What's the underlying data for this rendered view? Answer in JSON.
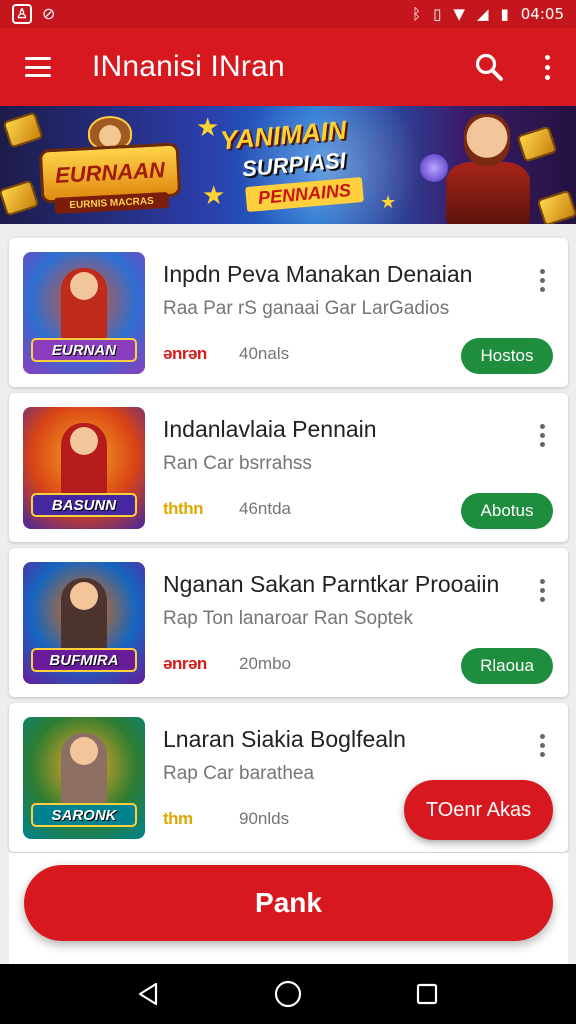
{
  "status_bar": {
    "time": "04:05",
    "left_icons": [
      "app-notification-icon",
      "muted-icon"
    ],
    "right_icons": [
      "bluetooth-icon",
      "vibrate-icon",
      "wifi-icon",
      "signal-icon",
      "battery-icon"
    ]
  },
  "app_bar": {
    "title": "INnanisi INran",
    "menu_icon": "hamburger-menu-icon",
    "search_icon": "search-icon",
    "more_icon": "more-vertical-icon"
  },
  "banner": {
    "logo_text": "EURNAAN",
    "logo_subtext": "EURNIS MACRAS",
    "headline_1": "YANIMAIN",
    "headline_2": "SURPIASI",
    "headline_3": "PENNAINS"
  },
  "items": [
    {
      "title": "Inpdn Peva Manakan Denaian",
      "subtitle": "Raa Par rS ganaai Gar LarGadios",
      "rating": "ənrən",
      "count": "40nals",
      "action": "Hostos",
      "thumb_label": "EURNAN",
      "thumb_colors": [
        "#2e6fd1",
        "#e0542a",
        "#8a3dbf"
      ],
      "fig_color": "#c02a1a",
      "rating_style": "red"
    },
    {
      "title": "Indanlavlaia Pennain",
      "subtitle": "Ran Car bsrrahss",
      "rating": "ththn",
      "count": "46ntda",
      "action": "Abotus",
      "thumb_label": "BASUNN",
      "thumb_colors": [
        "#d84315",
        "#f9a825",
        "#4527a0"
      ],
      "fig_color": "#b71c1c",
      "rating_style": "gold"
    },
    {
      "title": "Nganan Sakan Parntkar Prooaiin",
      "subtitle": "Rap Ton lanaroar Ran Soptek",
      "rating": "ənrən",
      "count": "20mbo",
      "action": "Rlaoua",
      "thumb_label": "BUFMIRA",
      "thumb_colors": [
        "#1565c0",
        "#ef6c00",
        "#6a1b9a"
      ],
      "fig_color": "#4e342e",
      "rating_style": "red"
    },
    {
      "title": "Lnaran Siakia Boglfealn",
      "subtitle": "Rap Car barathea",
      "rating": "thm",
      "count": "90nlds",
      "action": "",
      "thumb_label": "SARONK",
      "thumb_colors": [
        "#2e7d32",
        "#f9a825",
        "#00838f"
      ],
      "fig_color": "#8d6e63",
      "rating_style": "gold"
    }
  ],
  "floating_button": "TOenr Akas",
  "primary_button": "Pank",
  "nav": [
    "back-icon",
    "home-icon",
    "recents-icon"
  ],
  "colors": {
    "brand_red": "#d7191f",
    "action_green": "#1e8e3e",
    "background": "#eeeeee"
  }
}
